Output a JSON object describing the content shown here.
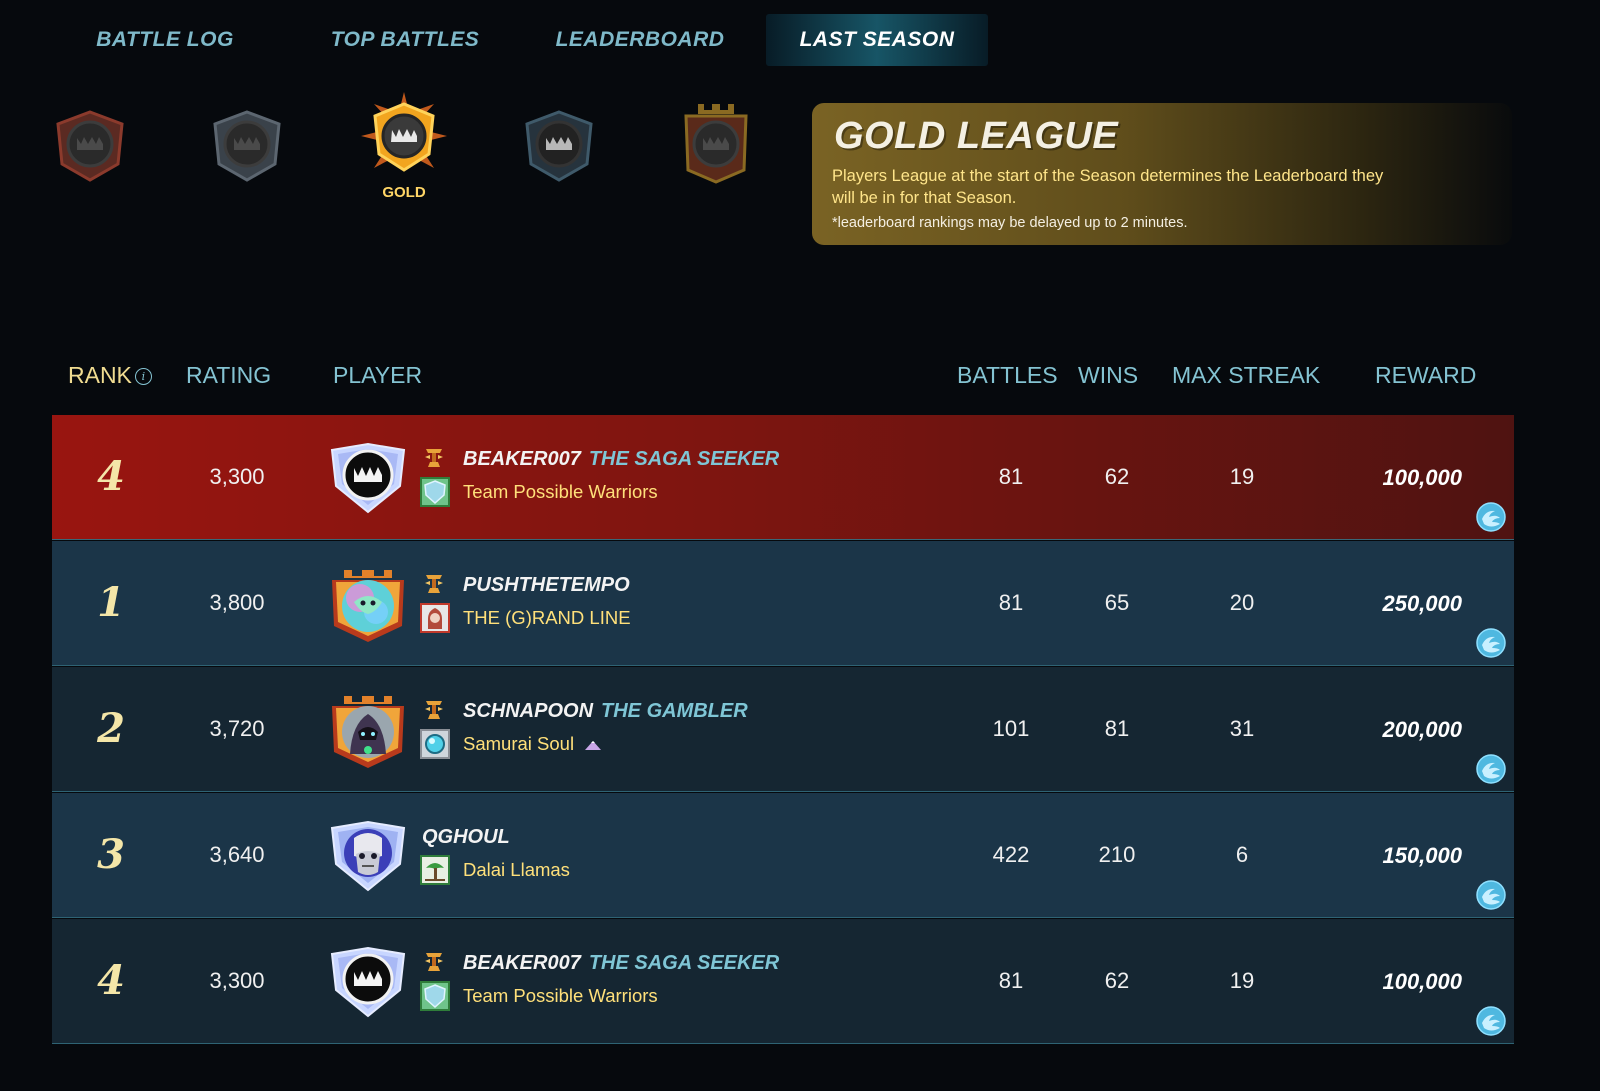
{
  "tabs": [
    {
      "label": "BATTLE LOG",
      "active": false
    },
    {
      "label": "TOP BATTLES",
      "active": false
    },
    {
      "label": "LEADERBOARD",
      "active": false
    },
    {
      "label": "LAST SEASON",
      "active": true
    }
  ],
  "leagues": [
    {
      "name": "bronze",
      "label": "",
      "color": "#8b3a2c"
    },
    {
      "name": "silver",
      "label": "",
      "color": "#5c6670"
    },
    {
      "name": "gold",
      "label": "GOLD",
      "color": "#f2a51f",
      "selected": true
    },
    {
      "name": "diamond",
      "label": "",
      "color": "#3f5a6a"
    },
    {
      "name": "champion",
      "label": "",
      "color": "#8a6a22"
    }
  ],
  "league_info": {
    "title": "GOLD LEAGUE",
    "description": "Players League at the start of the Season determines the Leaderboard they will be in for that Season.",
    "note": "*leaderboard rankings may be delayed up to 2 minutes."
  },
  "table": {
    "headers": {
      "rank": "RANK",
      "rating": "RATING",
      "player": "PLAYER",
      "battles": "BATTLES",
      "wins": "WINS",
      "max_streak": "MAX STREAK",
      "reward": "REWARD"
    },
    "rows": [
      {
        "rank": "4",
        "rating": "3,300",
        "player": "BEAKER007",
        "title": "THE SAGA SEEKER",
        "guild": "Team Possible Warriors",
        "battles": "81",
        "wins": "62",
        "max_streak": "19",
        "reward": "100,000",
        "style": "me",
        "avatar": "gold-plain",
        "guild_icon": "shield-icon"
      },
      {
        "rank": "1",
        "rating": "3,800",
        "player": "PUSHTHETEMPO",
        "title": "",
        "guild": "THE (G)RAND LINE",
        "battles": "81",
        "wins": "65",
        "max_streak": "20",
        "reward": "250,000",
        "style": "light",
        "avatar": "champion-dragon",
        "guild_icon": "hooded-icon"
      },
      {
        "rank": "2",
        "rating": "3,720",
        "player": "SCHNAPOON",
        "title": "THE GAMBLER",
        "guild": "Samurai Soul",
        "battles": "101",
        "wins": "81",
        "max_streak": "31",
        "reward": "200,000",
        "style": "dark",
        "avatar": "champion-mage",
        "guild_icon": "orb-icon"
      },
      {
        "rank": "3",
        "rating": "3,640",
        "player": "QGHOUL",
        "title": "",
        "guild": "Dalai Llamas",
        "battles": "422",
        "wins": "210",
        "max_streak": "6",
        "reward": "150,000",
        "style": "light",
        "avatar": "diamond-ghoul",
        "guild_icon": "tree-icon"
      },
      {
        "rank": "4",
        "rating": "3,300",
        "player": "BEAKER007",
        "title": "THE SAGA SEEKER",
        "guild": "Team Possible Warriors",
        "battles": "81",
        "wins": "62",
        "max_streak": "19",
        "reward": "100,000",
        "style": "dark",
        "avatar": "gold-plain",
        "guild_icon": "shield-icon"
      }
    ]
  },
  "colors": {
    "accent": "#7fb9c9",
    "rank_text": "#f0dc91",
    "guild_text": "#ffe07a",
    "my_row": "#991510"
  }
}
